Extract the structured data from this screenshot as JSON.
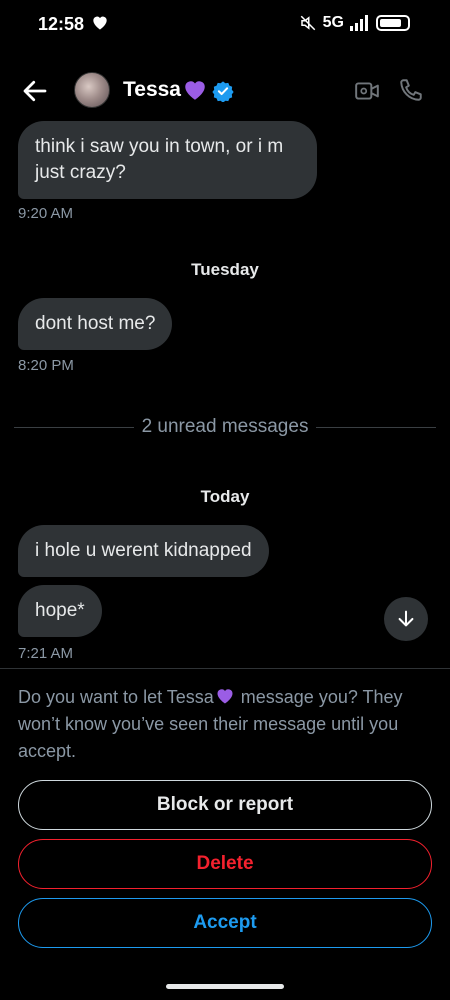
{
  "status_bar": {
    "time": "12:58",
    "network": "5G",
    "battery_level": 0.8
  },
  "header": {
    "name": "Tessa"
  },
  "messages": [
    {
      "text": "think i saw you in town, or i m just crazy?",
      "time": "9:20 AM"
    },
    {
      "day": "Tuesday"
    },
    {
      "text": "dont host me?",
      "time": "8:20 PM"
    },
    {
      "unread": "2 unread messages"
    },
    {
      "day": "Today"
    },
    {
      "text": "i hole u werent kidnapped"
    },
    {
      "text": "hope*",
      "time": "7:21 AM"
    }
  ],
  "request": {
    "prompt_before": "Do you want to let Tessa",
    "prompt_after": " message you? They won’t know you’ve seen their message until you accept.",
    "block_label": "Block or report",
    "delete_label": "Delete",
    "accept_label": "Accept"
  },
  "colors": {
    "accent": "#1d9bf0",
    "danger": "#f4212e",
    "bubble": "#2f3336",
    "heart": "#9b5de5"
  }
}
